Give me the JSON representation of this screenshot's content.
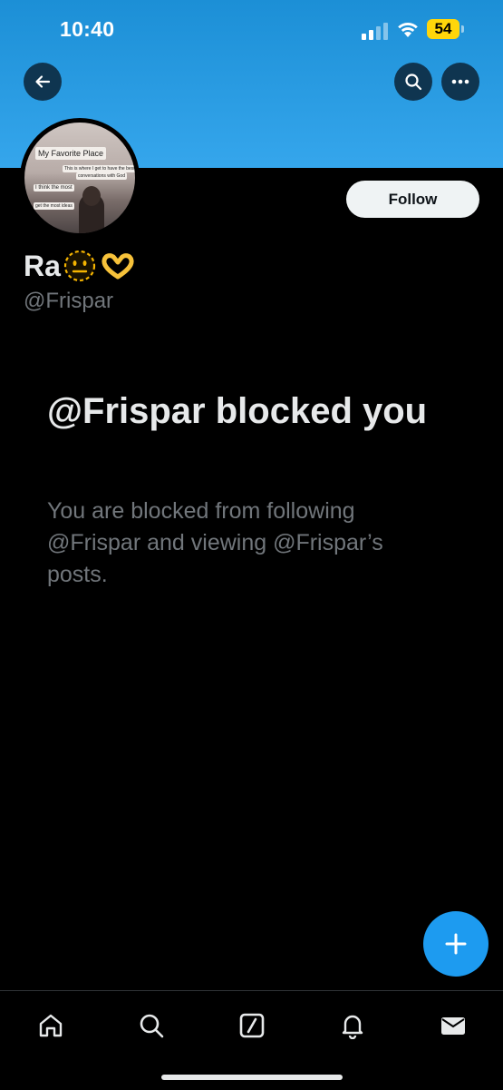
{
  "status_bar": {
    "time": "10:40",
    "battery_level": "54"
  },
  "header": {
    "back_icon": "arrow-left-icon",
    "search_icon": "search-icon",
    "more_icon": "more-horizontal-icon"
  },
  "profile": {
    "name": "Ra",
    "name_emojis": [
      "neutral-face-emoji",
      "heart-hands-emoji"
    ],
    "handle": "@Frispar",
    "follow_label": "Follow",
    "avatar": {
      "title": "My Favorite Place",
      "line1": "This is where I get to have the best",
      "line2": "conversations with God",
      "line3": "I think the most",
      "line4": "get the most ideas"
    }
  },
  "blocked": {
    "title": "@Frispar blocked you",
    "message": "You are blocked from following @Frispar and viewing @Frispar’s posts."
  },
  "fab": {
    "icon": "plus-icon"
  },
  "tab_bar": [
    {
      "name": "home",
      "icon": "home-icon"
    },
    {
      "name": "search",
      "icon": "search-icon"
    },
    {
      "name": "grok",
      "icon": "grok-icon"
    },
    {
      "name": "notifications",
      "icon": "bell-icon"
    },
    {
      "name": "messages",
      "icon": "mail-icon"
    }
  ],
  "colors": {
    "accent": "#1d9bf0",
    "background": "#000000",
    "banner": "#2a9be3",
    "muted": "#71767b"
  }
}
